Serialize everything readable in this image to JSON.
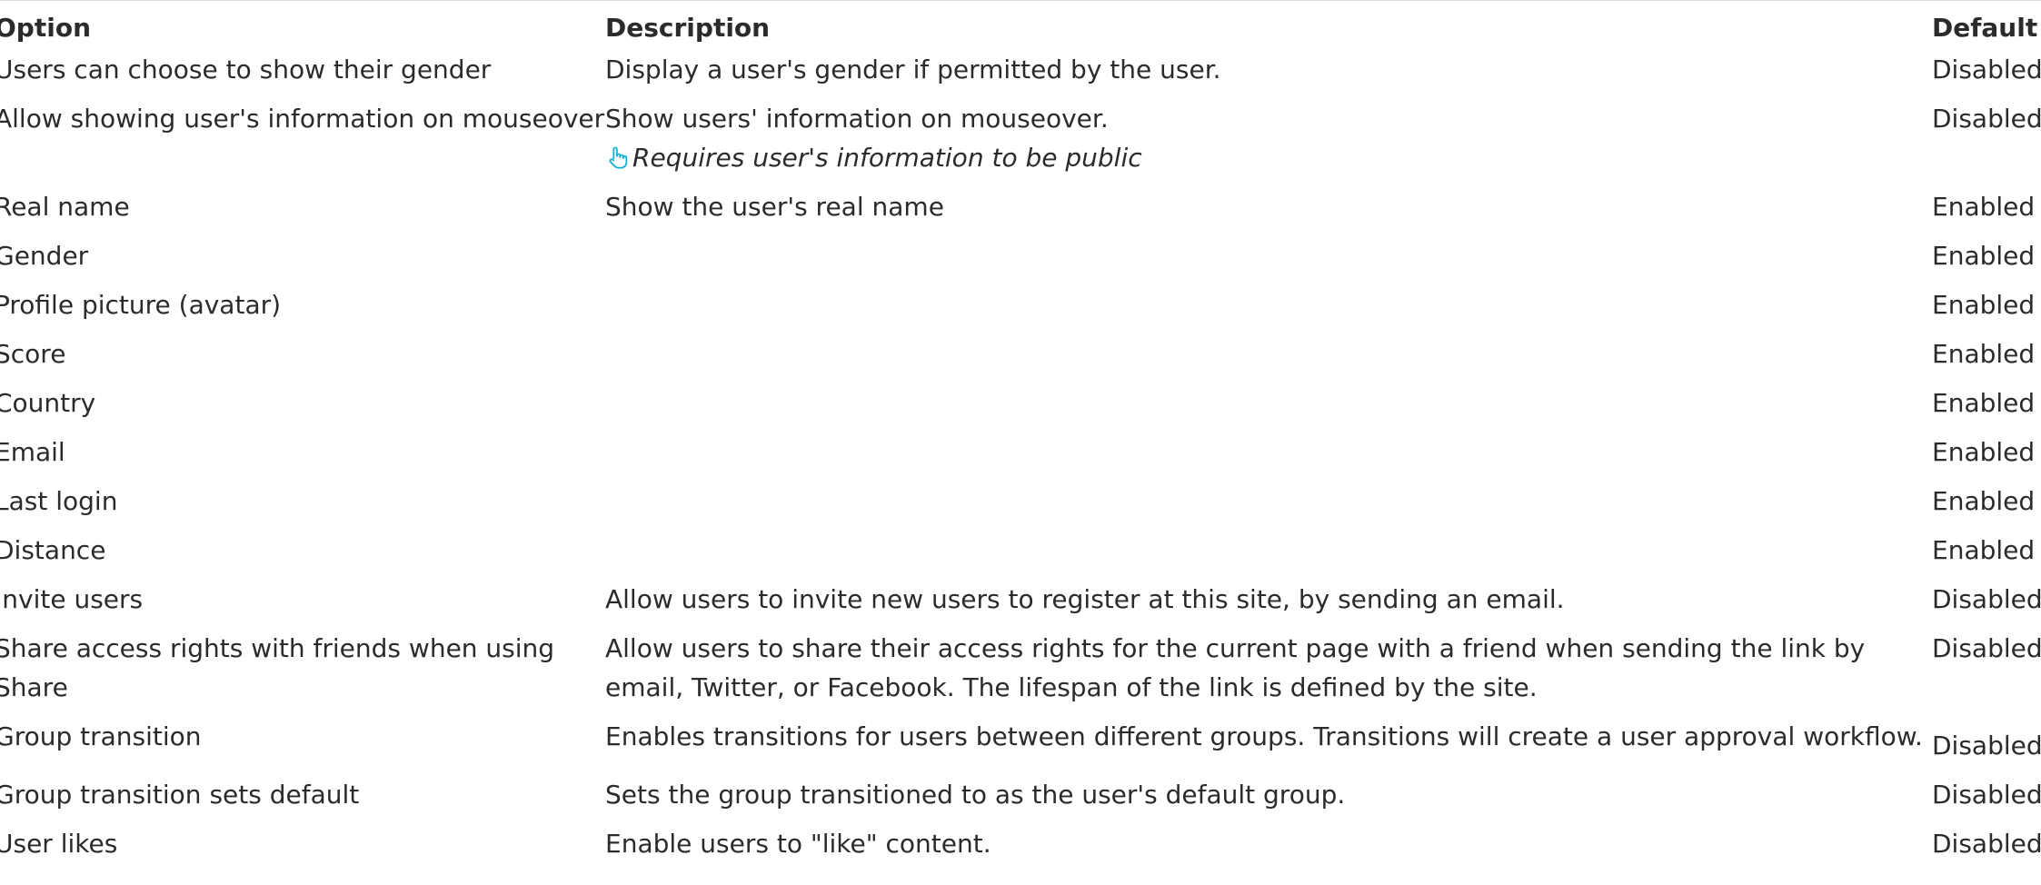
{
  "headers": {
    "option": "Option",
    "description": "Description",
    "default": "Default"
  },
  "rows": [
    {
      "option": "Users can choose to show their gender",
      "description": "Display a user's gender if permitted by the user.",
      "default": "Disabled"
    },
    {
      "option": "Allow showing user's information on mouseover",
      "description": "Show users' information on mouseover.",
      "note": "Requires user's information to be public",
      "note_icon": "pointing-hand-icon",
      "default": "Disabled"
    },
    {
      "option": "Real name",
      "description": "Show the user's real name",
      "default": "Enabled"
    },
    {
      "option": "Gender",
      "description": "",
      "default": "Enabled"
    },
    {
      "option": "Profile picture (avatar)",
      "description": "",
      "default": "Enabled"
    },
    {
      "option": "Score",
      "description": "",
      "default": "Enabled"
    },
    {
      "option": "Country",
      "description": "",
      "default": "Enabled"
    },
    {
      "option": "Email",
      "description": "",
      "default": "Enabled"
    },
    {
      "option": "Last login",
      "description": "",
      "default": "Enabled"
    },
    {
      "option": "Distance",
      "description": "",
      "default": "Enabled"
    },
    {
      "option": "Invite users",
      "description": "Allow users to invite new users to register at this site, by sending an email.",
      "default": "Disabled"
    },
    {
      "option": "Share access rights with friends when using Share",
      "description": "Allow users to share their access rights for the current page with a friend when sending the link by email, Twitter, or Facebook. The lifespan of the link is defined by the site.",
      "default": "Disabled"
    },
    {
      "option": "Group transition",
      "description": "Enables transitions for users between different groups. Transitions will create a user approval workflow.",
      "default": "Disabled"
    },
    {
      "option": "Group transition sets default",
      "description": "Sets the group transitioned to as the user's default group.",
      "default": "Disabled"
    },
    {
      "option": "User likes",
      "description": "Enable users to \"like\" content.",
      "default": "Disabled"
    }
  ],
  "colors": {
    "text": "#2b2b2b",
    "note_icon": "#1ab0d8"
  }
}
